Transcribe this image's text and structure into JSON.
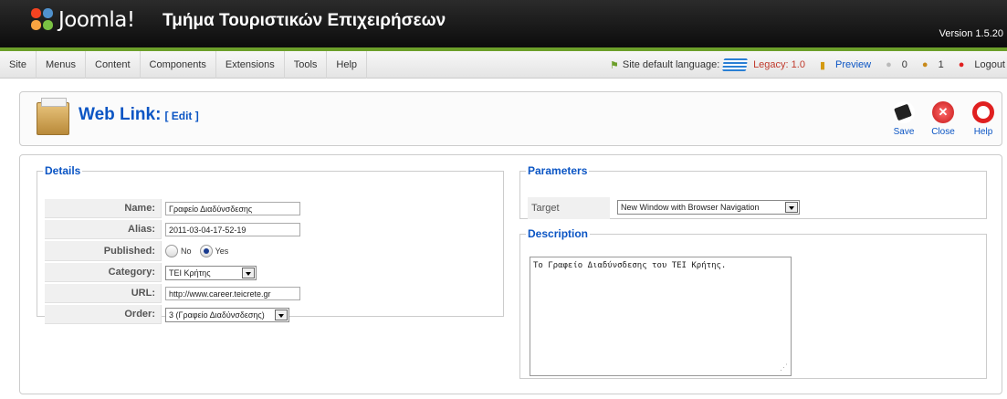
{
  "header": {
    "logo_text": "Joomla!",
    "site_title": "Τμήμα Τουριστικών Επιχειρήσεων",
    "version": "Version 1.5.20"
  },
  "menubar": {
    "items": [
      "Site",
      "Menus",
      "Content",
      "Components",
      "Extensions",
      "Tools",
      "Help"
    ],
    "language_label": "Site default language:",
    "legacy": "Legacy: 1.0",
    "preview": "Preview",
    "messages_count": "0",
    "users_count": "1",
    "logout": "Logout"
  },
  "toolbar": {
    "title": "Web Link:",
    "subtitle": "[ Edit ]",
    "save": "Save",
    "close": "Close",
    "help": "Help"
  },
  "details": {
    "legend": "Details",
    "name_label": "Name:",
    "name_value": "Γραφείο Διαδύνσδεσης",
    "alias_label": "Alias:",
    "alias_value": "2011-03-04-17-52-19",
    "published_label": "Published:",
    "published_no": "No",
    "published_yes": "Yes",
    "category_label": "Category:",
    "category_value": "ΤΕΙ Κρήτης",
    "url_label": "URL:",
    "url_value": "http://www.career.teicrete.gr",
    "order_label": "Order:",
    "order_value": "3 (Γραφείο Διαδύνσδεσης)"
  },
  "parameters": {
    "legend": "Parameters",
    "target_label": "Target",
    "target_value": "New Window with Browser Navigation"
  },
  "description": {
    "legend": "Description",
    "text": "Το Γραφείο Διαδύνσδεσης του ΤΕΙ Κρήτης."
  },
  "colors": {
    "accent_blue": "#0b55c4",
    "green_bar": "#6c9f2a",
    "legacy_red": "#c0392b"
  }
}
